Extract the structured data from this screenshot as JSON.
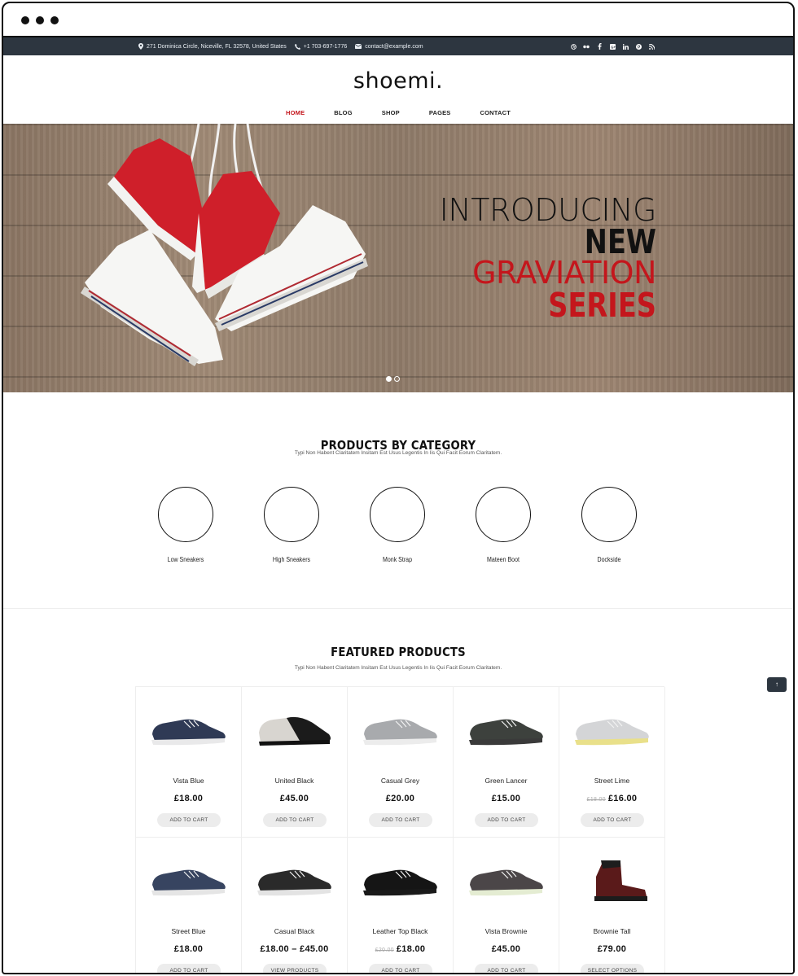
{
  "topbar": {
    "address": "271 Dominica Circle, Niceville, FL 32578, United States",
    "phone": "+1 703-697-1776",
    "email": "contact@example.com",
    "social_icons": [
      "dribbble-icon",
      "flickr-icon",
      "facebook-icon",
      "google-plus-icon",
      "linkedin-icon",
      "pinterest-icon",
      "rss-icon"
    ]
  },
  "header": {
    "logo": "shoemi.",
    "nav": [
      {
        "label": "HOME",
        "active": true
      },
      {
        "label": "BLOG",
        "active": false
      },
      {
        "label": "SHOP",
        "active": false
      },
      {
        "label": "PAGES",
        "active": false
      },
      {
        "label": "CONTACT",
        "active": false
      }
    ]
  },
  "hero": {
    "line1": "INTRODUCING",
    "line2": "NEW",
    "line3": "GRAVIATION",
    "line4": "SERIES",
    "accent_color": "#c4161c",
    "slides": 2,
    "active_slide": 1
  },
  "categories": {
    "title": "PRODUCTS BY CATEGORY",
    "subtitle": "Typi Non Habent Claritatem Insitam Est Usus Legentis In Iis Qui Facit Eorum Claritatem.",
    "items": [
      {
        "label": "Low Sneakers"
      },
      {
        "label": "High Sneakers"
      },
      {
        "label": "Monk Strap"
      },
      {
        "label": "Mateen Boot"
      },
      {
        "label": "Dockside"
      }
    ]
  },
  "featured": {
    "title": "FEATURED PRODUCTS",
    "subtitle": "Typi Non Habent Claritatem Insitam Est Usus Legentis In Iis Qui Facit Eorum Claritatem.",
    "back_to_top_icon": "arrow-up-icon",
    "products": [
      {
        "name": "Vista Blue",
        "old_price": "",
        "price": "£18.00",
        "button": "ADD TO CART",
        "color": "#2f3a55",
        "sole": "#e9e9ea",
        "type": "low"
      },
      {
        "name": "United Black",
        "old_price": "",
        "price": "£45.00",
        "button": "ADD TO CART",
        "color": "#1b1b1b",
        "sole": "#d8d6d2",
        "type": "knit"
      },
      {
        "name": "Casual Grey",
        "old_price": "",
        "price": "£20.00",
        "button": "ADD TO CART",
        "color": "#a8aaad",
        "sole": "#ececec",
        "type": "low"
      },
      {
        "name": "Green Lancer",
        "old_price": "",
        "price": "£15.00",
        "button": "ADD TO CART",
        "color": "#3d413d",
        "sole": "#3a3a3a",
        "type": "low"
      },
      {
        "name": "Street Lime",
        "old_price": "£18.00",
        "price": "£16.00",
        "button": "ADD TO CART",
        "color": "#d4d5d7",
        "sole": "#e9e08a",
        "type": "low"
      },
      {
        "name": "Street Blue",
        "old_price": "",
        "price": "£18.00",
        "button": "ADD TO CART",
        "color": "#374460",
        "sole": "#e5e5e5",
        "type": "low"
      },
      {
        "name": "Casual Black",
        "old_price": "",
        "price": "£18.00 – £45.00",
        "button": "VIEW PRODUCTS",
        "color": "#2a2a2a",
        "sole": "#e3e3e3",
        "type": "low"
      },
      {
        "name": "Leather Top Black",
        "old_price": "£20.00",
        "price": "£18.00",
        "button": "ADD TO CART",
        "color": "#151515",
        "sole": "#1a1a1a",
        "type": "low"
      },
      {
        "name": "Vista Brownie",
        "old_price": "",
        "price": "£45.00",
        "button": "ADD TO CART",
        "color": "#4b4648",
        "sole": "#e4ecd2",
        "type": "low"
      },
      {
        "name": "Brownie Tall",
        "old_price": "",
        "price": "£79.00",
        "button": "SELECT OPTIONS",
        "color": "#5a1a1a",
        "sole": "#1c1c1c",
        "type": "boot"
      }
    ]
  }
}
